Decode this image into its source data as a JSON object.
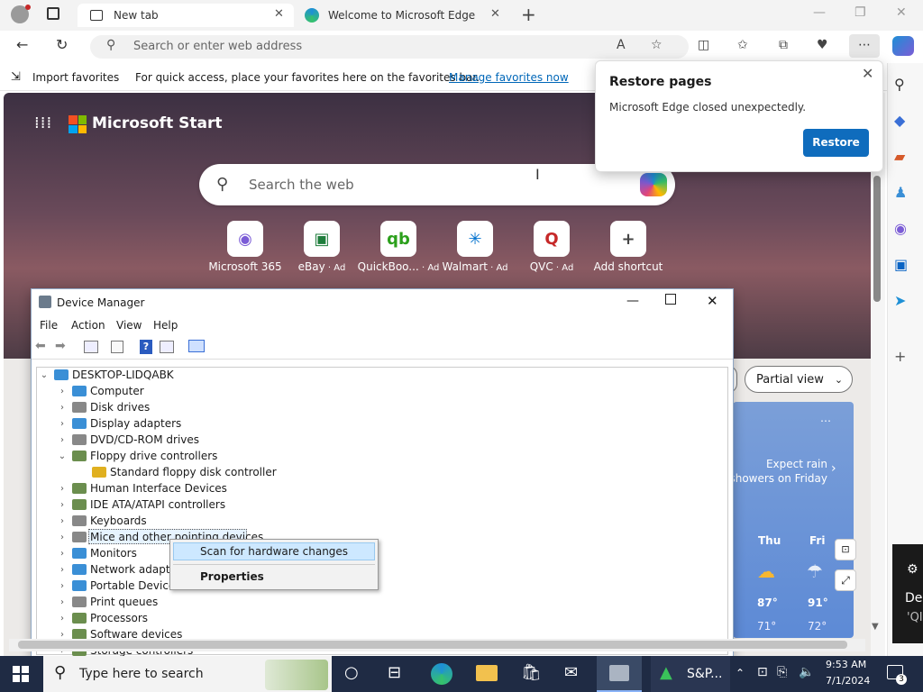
{
  "browser": {
    "tabs": [
      {
        "label": "New tab",
        "active": true
      },
      {
        "label": "Welcome to Microsoft Edge",
        "active": false
      }
    ],
    "address_placeholder": "Search or enter web address",
    "favbar": {
      "import_label": "Import favorites",
      "hint": "For quick access, place your favorites here on the favorites bar.",
      "manage_link": "Manage favorites now"
    }
  },
  "restore_popup": {
    "title": "Restore pages",
    "message": "Microsoft Edge closed unexpectedly.",
    "button": "Restore"
  },
  "ntp": {
    "brand": "Microsoft Start",
    "search_placeholder": "Search the web",
    "tiles": [
      {
        "label": "Microsoft 365",
        "ad": "",
        "glyph": "◉",
        "color": "#7b5cd6"
      },
      {
        "label": "eBay",
        "ad": "Ad",
        "glyph": "▣",
        "color": "#1f7d3c"
      },
      {
        "label": "QuickBoo...",
        "ad": "Ad",
        "glyph": "qb",
        "color": "#2ca01c"
      },
      {
        "label": "Walmart",
        "ad": "Ad",
        "glyph": "✳",
        "color": "#0071ce"
      },
      {
        "label": "QVC",
        "ad": "Ad",
        "glyph": "Q",
        "color": "#c62828"
      },
      {
        "label": "Add shortcut",
        "ad": "",
        "glyph": "+",
        "color": "#444444"
      }
    ],
    "view_dropdown": "Partial view",
    "weather": {
      "forecast": "Expect rain showers on Friday",
      "days": [
        {
          "name": "Thu",
          "high": "87°",
          "low": "71°"
        },
        {
          "name": "Fri",
          "high": "91°",
          "low": "72°"
        }
      ]
    },
    "right_panel": {
      "line1": "De",
      "line2": "'QI"
    }
  },
  "device_manager": {
    "title": "Device Manager",
    "menu": [
      "File",
      "Action",
      "View",
      "Help"
    ],
    "root": "DESKTOP-LIDQABK",
    "items": [
      {
        "label": "Computer",
        "expanded": false,
        "color": "#3a8fd6"
      },
      {
        "label": "Disk drives",
        "expanded": false,
        "color": "#888888"
      },
      {
        "label": "Display adapters",
        "expanded": false,
        "color": "#3a8fd6"
      },
      {
        "label": "DVD/CD-ROM drives",
        "expanded": false,
        "color": "#888888"
      },
      {
        "label": "Floppy drive controllers",
        "expanded": true,
        "color": "#6b8e4e"
      },
      {
        "label": "Standard floppy disk controller",
        "child": true,
        "color": "#e0b020"
      },
      {
        "label": "Human Interface Devices",
        "expanded": false,
        "color": "#6b8e4e"
      },
      {
        "label": "IDE ATA/ATAPI controllers",
        "expanded": false,
        "color": "#6b8e4e"
      },
      {
        "label": "Keyboards",
        "expanded": false,
        "color": "#888888"
      },
      {
        "label": "Mice and other pointing devices",
        "expanded": false,
        "color": "#888888"
      },
      {
        "label": "Monitors",
        "expanded": false,
        "color": "#3a8fd6"
      },
      {
        "label": "Network adapters",
        "expanded": false,
        "color": "#3a8fd6"
      },
      {
        "label": "Portable Devices",
        "expanded": false,
        "color": "#3a8fd6"
      },
      {
        "label": "Print queues",
        "expanded": false,
        "color": "#888888"
      },
      {
        "label": "Processors",
        "expanded": false,
        "color": "#6b8e4e"
      },
      {
        "label": "Software devices",
        "expanded": false,
        "color": "#6b8e4e"
      },
      {
        "label": "Storage controllers",
        "expanded": false,
        "color": "#6b8e4e"
      }
    ],
    "context_menu": [
      "Scan for hardware changes",
      "Properties"
    ]
  },
  "taskbar": {
    "search_placeholder": "Type here to search",
    "stock": "S&P...",
    "time": "9:53 AM",
    "date": "7/1/2024",
    "notifications": "3"
  }
}
